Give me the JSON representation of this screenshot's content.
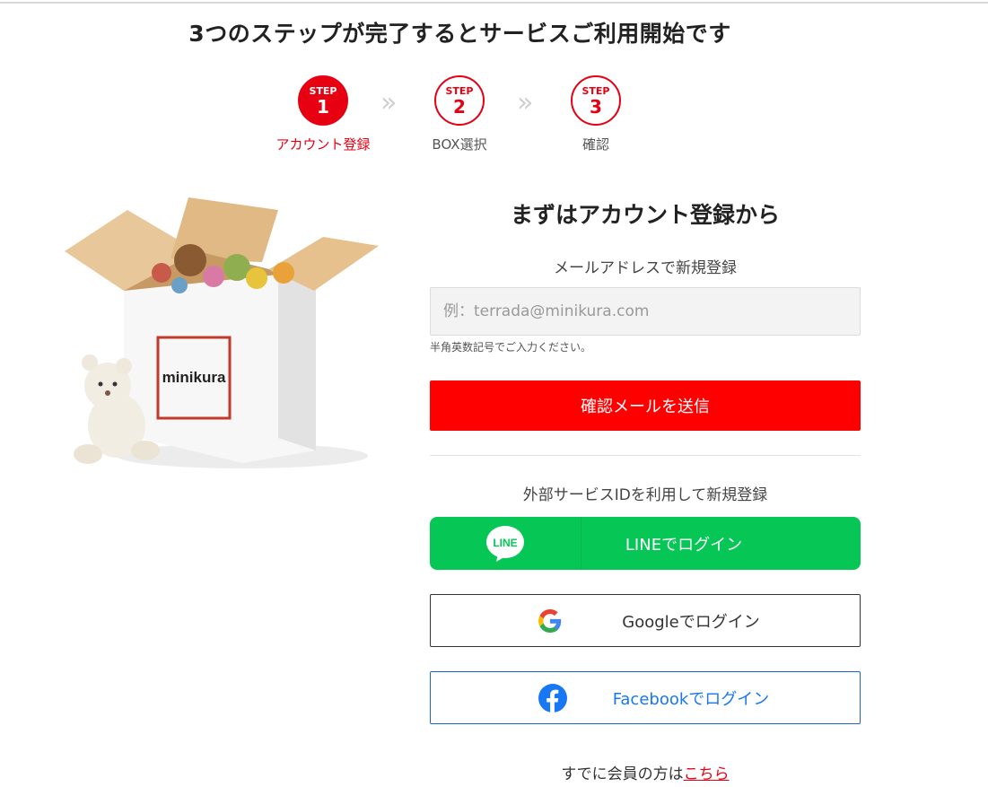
{
  "page": {
    "title": "3つのステップが完了するとサービスご利用開始です"
  },
  "steps": [
    {
      "word": "STEP",
      "number": "1",
      "label": "アカウント登録",
      "active": true
    },
    {
      "word": "STEP",
      "number": "2",
      "label": "BOX選択",
      "active": false
    },
    {
      "word": "STEP",
      "number": "3",
      "label": "確認",
      "active": false
    }
  ],
  "step_separator": "»",
  "hero": {
    "brand_text": "minikura"
  },
  "signup": {
    "title": "まずはアカウント登録から",
    "email_section_label": "メールアドレスで新規登録",
    "email_placeholder": "例：terrada@minikura.com",
    "email_value": "",
    "email_hint": "半角英数記号でご入力ください。",
    "send_button": "確認メールを送信",
    "external_section_label": "外部サービスIDを利用して新規登録",
    "line_button": "LINEでログイン",
    "line_icon_text": "LINE",
    "google_button": "Googleでログイン",
    "facebook_button": "Facebookでログイン",
    "member_prefix": "すでに会員の方は",
    "member_link": "こちら"
  },
  "colors": {
    "accent_red": "#e60012",
    "send_button": "#ff0000",
    "line_green": "#06c755",
    "facebook_blue": "#1877f2"
  }
}
